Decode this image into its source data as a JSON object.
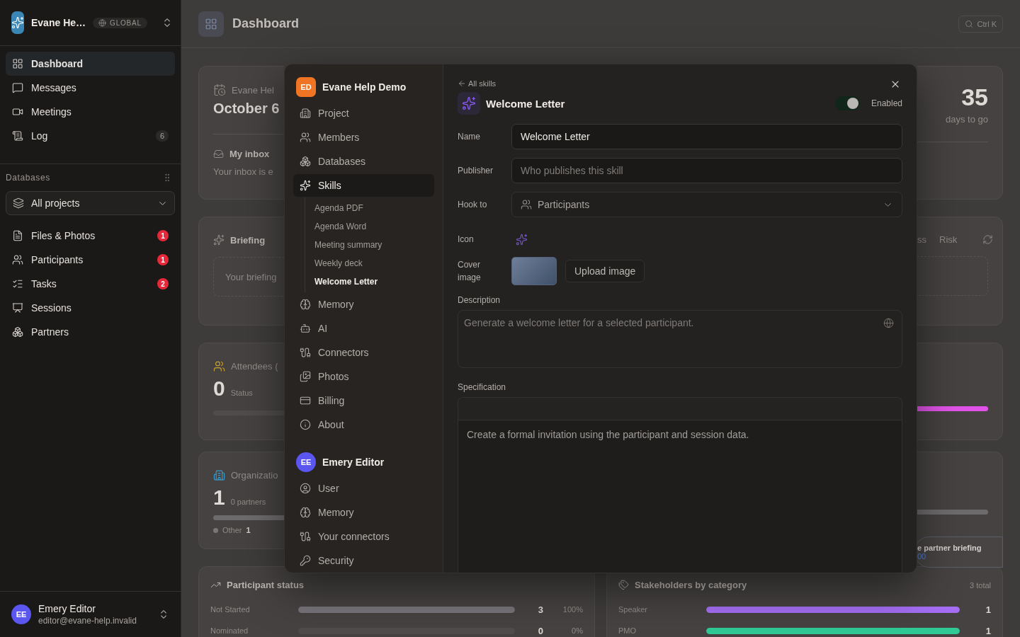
{
  "sidebar": {
    "workspace": {
      "name": "Evane He…",
      "scope": "GLOBAL"
    },
    "nav": [
      {
        "label": "Dashboard",
        "selected": true
      },
      {
        "label": "Messages",
        "selected": false
      },
      {
        "label": "Meetings",
        "selected": false
      },
      {
        "label": "Log",
        "selected": false,
        "count": "6"
      }
    ],
    "section_title": "Databases",
    "project_select": {
      "value": "All projects"
    },
    "database_items": [
      {
        "label": "Files & Photos",
        "count": "1"
      },
      {
        "label": "Participants",
        "count": "1"
      },
      {
        "label": "Tasks",
        "count": "2"
      },
      {
        "label": "Sessions"
      },
      {
        "label": "Partners"
      }
    ],
    "user": {
      "initials": "EE",
      "name": "Emery Editor",
      "email": "editor@evane-help.invalid"
    }
  },
  "header": {
    "title": "Dashboard",
    "search_shortcut": "Ctrl K"
  },
  "background": {
    "event_card": {
      "title": "Evane Hel",
      "date": "October 6",
      "inbox_title": "My inbox",
      "inbox_text": "Your inbox is e",
      "countdown": "35",
      "countdown_label": "days to go"
    },
    "briefing_card": {
      "title": "Briefing",
      "placeholder": "Your briefing",
      "tabs": [
        "ss",
        "Risk"
      ]
    },
    "attendees_card": {
      "title": "Attendees (",
      "count": "0",
      "label": "Status"
    },
    "organizations_card": {
      "title": "Organizatio",
      "count": "1",
      "label": "0 partners",
      "legend": {
        "label": "Other",
        "count": "1"
      }
    },
    "toast": {
      "text": "e partner briefing",
      "link": "00"
    },
    "participant_status": {
      "title": "Participant status",
      "rows": [
        {
          "label": "Not Started",
          "level": 1,
          "count": "3",
          "percent": "100%"
        },
        {
          "label": "Nominated",
          "level": 0,
          "count": "0",
          "percent": "0%"
        }
      ]
    },
    "stakeholders": {
      "title": "Stakeholders by category",
      "total": "3 total",
      "rows": [
        {
          "label": "Speaker",
          "level": 1,
          "count": "1",
          "color": "#a56ef5"
        },
        {
          "label": "PMO",
          "level": 1,
          "count": "1",
          "color": "#2fc995"
        }
      ]
    }
  },
  "dialog": {
    "org": {
      "initials": "ED",
      "name": "Evane Help Demo",
      "items": [
        {
          "label": "Project",
          "selected": false
        },
        {
          "label": "Members",
          "selected": false
        },
        {
          "label": "Databases",
          "selected": false
        },
        {
          "label": "Skills",
          "selected": true,
          "children": [
            {
              "label": "Agenda PDF",
              "selected": false
            },
            {
              "label": "Agenda Word",
              "selected": false
            },
            {
              "label": "Meeting summary",
              "selected": false
            },
            {
              "label": "Weekly deck",
              "selected": false
            },
            {
              "label": "Welcome Letter",
              "selected": true
            }
          ]
        },
        {
          "label": "Memory",
          "selected": false
        },
        {
          "label": "AI",
          "selected": false
        },
        {
          "label": "Connectors",
          "selected": false
        },
        {
          "label": "Photos",
          "selected": false
        },
        {
          "label": "Billing",
          "selected": false
        },
        {
          "label": "About",
          "selected": false
        }
      ]
    },
    "user": {
      "initials": "EE",
      "name": "Emery Editor",
      "items": [
        {
          "label": "User",
          "selected": false
        },
        {
          "label": "Memory",
          "selected": false
        },
        {
          "label": "Your connectors",
          "selected": false
        },
        {
          "label": "Security",
          "selected": false
        }
      ]
    },
    "back_link": "All skills",
    "skill": {
      "title": "Welcome Letter",
      "enabled": {
        "label": "Enabled",
        "on": true
      }
    },
    "fields": [
      {
        "kind": "text",
        "label": "Name",
        "value": "Welcome Letter"
      },
      {
        "kind": "text",
        "label": "Publisher",
        "placeholder": "Who publishes this skill"
      },
      {
        "kind": "select",
        "label": "Hook to",
        "value": "Participants"
      },
      {
        "kind": "icon",
        "label": "Icon"
      },
      {
        "kind": "cover",
        "label": "Cover image",
        "button": "Upload image"
      }
    ],
    "description": {
      "label": "Description",
      "placeholder": "Generate a welcome letter for a selected participant."
    },
    "specification": {
      "label": "Specification",
      "value": "Create a formal invitation using the participant and session data."
    }
  }
}
